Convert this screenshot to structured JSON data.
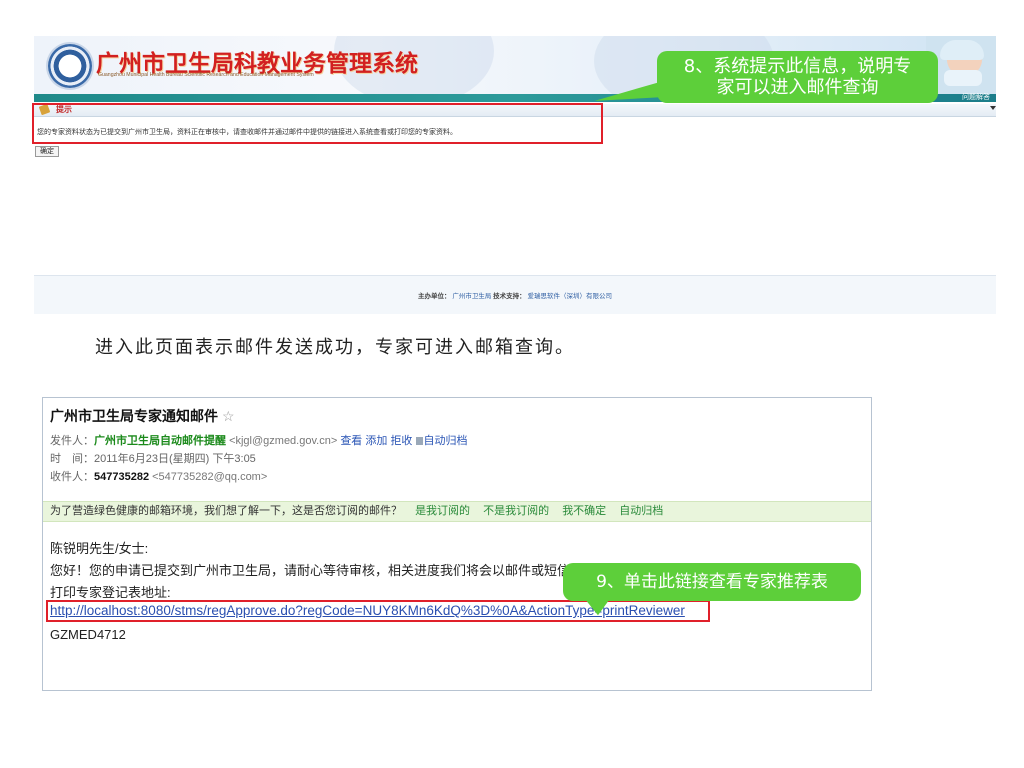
{
  "header": {
    "title": "广州市卫生局科教业务管理系统",
    "subtitle": "Guangzhou Municipal Health Bureau Scientific Research and Education Management System",
    "nav_link": "问题解答"
  },
  "tip": {
    "title": "提示",
    "message": "您的专家资料状态为已提交到广州市卫生局，资料正在审核中，请查收邮件并通过邮件中提供的链接进入系统查看或打印您的专家资料。",
    "confirm_label": "确定"
  },
  "callout_8": {
    "line1": "8、系统提示此信息，说明专",
    "line2": "家可以进入邮件查询"
  },
  "footer": {
    "host_label": "主办单位：",
    "host_value": "广州市卫生局",
    "support_label": "技术支持：",
    "support_value": "爱瑞思软件（深圳）有限公司"
  },
  "caption": "进入此页面表示邮件发送成功，专家可进入邮箱查询。",
  "email": {
    "subject": "广州市卫生局专家通知邮件",
    "from_label": "发件人：",
    "from_name": "广州市卫生局自动邮件提醒",
    "from_addr": "<kjgl@gzmed.gov.cn>",
    "action_view": "查看",
    "action_add": "添加",
    "action_reject": "拒收",
    "action_archive": "自动归档",
    "time_label": "时　间：",
    "time_value": "2011年6月23日(星期四) 下午3:05",
    "to_label": "收件人：",
    "to_name": "547735282",
    "to_addr": "<547735282@qq.com>",
    "feedback_question": "为了营造绿色健康的邮箱环境，我们想了解一下，这是否您订阅的邮件？",
    "feedback_yes": "是我订阅的",
    "feedback_no": "不是我订阅的",
    "feedback_unsure": "我不确定",
    "feedback_archive": "自动归档",
    "greeting": "陈锐明先生/女士:",
    "body": "您好！您的申请已提交到广州市卫生局，请耐心等待审核，相关进度我们将会以邮件或短信告知您",
    "print_label": "打印专家登记表地址:",
    "print_link": "http://localhost:8080/stms/regApprove.do?regCode=NUY8KMn6KdQ%3D%0A&ActionType=printReviewer",
    "ref_code": "GZMED4712"
  },
  "callout_9": "9、单击此链接查看专家推荐表"
}
